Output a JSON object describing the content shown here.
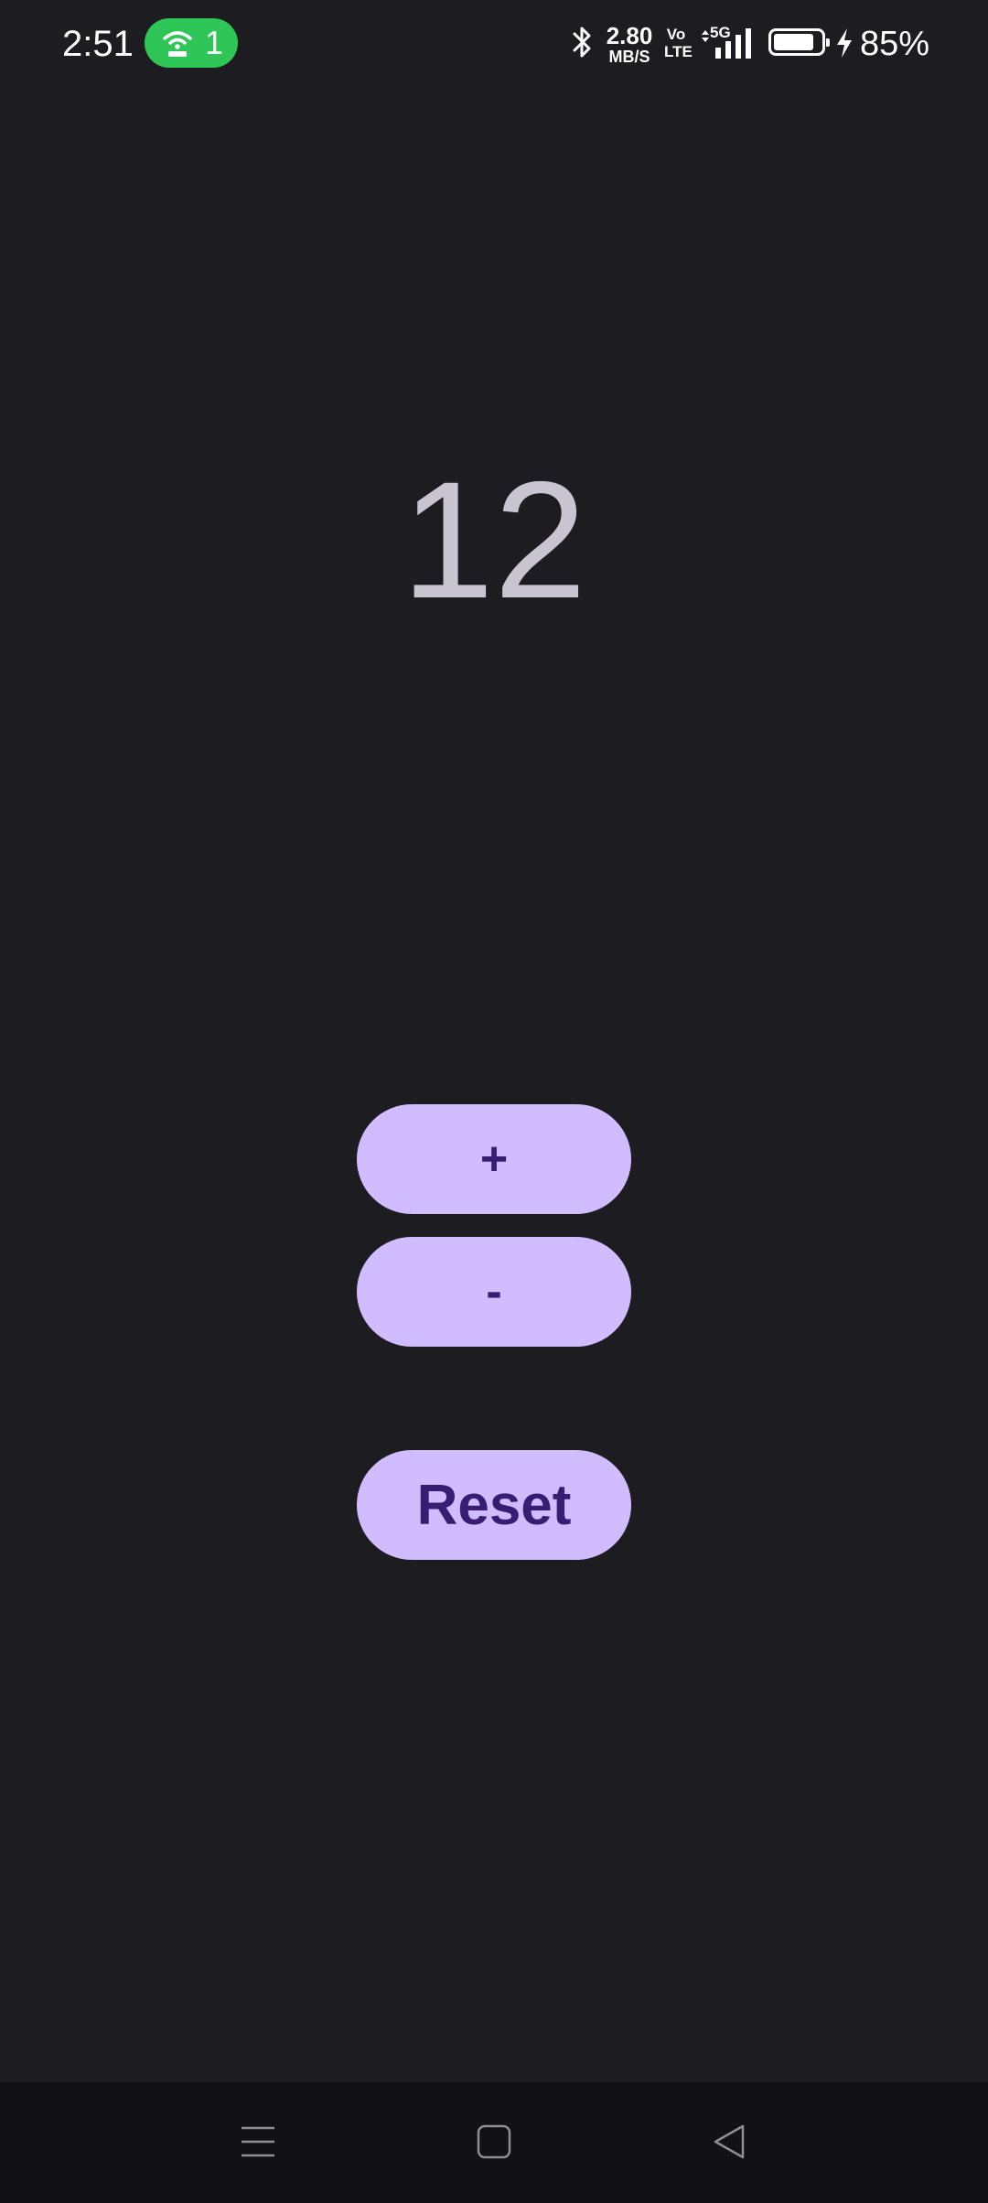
{
  "status_bar": {
    "time": "2:51",
    "hotspot_icon": "hotspot-icon",
    "hotspot_count": "1",
    "hotspot_color": "#2ec657",
    "bluetooth_icon": "bluetooth-icon",
    "network_speed": "2.80",
    "network_speed_unit": "MB/S",
    "volte_top": "Vo",
    "volte_bottom": "LTE",
    "network_type": "5G",
    "signal_icon": "signal-icon",
    "battery_icon": "battery-icon",
    "battery_level": 0.85,
    "charging_icon": "charging-bolt-icon",
    "battery_percent": "85%"
  },
  "counter": {
    "value": "12"
  },
  "buttons": {
    "increment_label": "+",
    "decrement_label": "-",
    "reset_label": "Reset"
  },
  "nav_bar": {
    "menu_icon": "recent-apps-icon",
    "home_icon": "home-icon",
    "back_icon": "back-icon"
  },
  "colors": {
    "background": "#1d1c21",
    "button_bg": "#d0bcff",
    "button_text": "#381e72",
    "counter_text": "#cac4d0",
    "nav_bg": "#121214"
  }
}
